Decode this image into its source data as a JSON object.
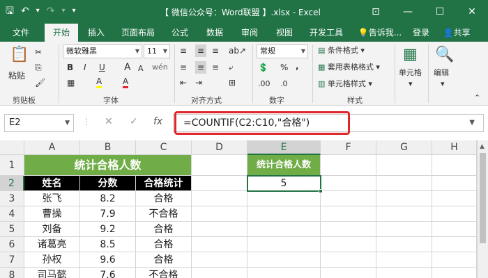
{
  "titlebar": {
    "title": "【 微信公众号：Word联盟 】.xlsx - Excel",
    "qat": {
      "save": "🖫",
      "undo": "↶",
      "undo_menu": "▾",
      "redo": "↷",
      "redo_menu": "▾",
      "customize": "▾"
    },
    "win": {
      "ribbon_opts": "⊡",
      "minimize": "—",
      "maximize": "☐",
      "close": "✕"
    }
  },
  "tabs": {
    "file": "文件",
    "home": "开始",
    "insert": "插入",
    "layout": "页面布局",
    "formulas": "公式",
    "data": "数据",
    "review": "审阅",
    "view": "视图",
    "developer": "开发工具",
    "tellme": "告诉我...",
    "signin": "登录",
    "share": "共享"
  },
  "ribbon": {
    "clipboard": {
      "label": "剪贴板",
      "paste": "粘贴",
      "cut": "✂",
      "copy": "⎘",
      "format_painter": "🖌"
    },
    "font": {
      "label": "字体",
      "name": "微软雅黑",
      "size": "11",
      "bold": "B",
      "italic": "I",
      "underline": "U",
      "grow": "A",
      "shrink": "A",
      "wen": "wén",
      "fill": "A",
      "fontcolor": "A"
    },
    "align": {
      "label": "对齐方式"
    },
    "number": {
      "label": "数字",
      "format": "常规",
      "percent": "%",
      "comma": ",",
      "inc": ".00",
      "dec": ".0"
    },
    "styles": {
      "label": "样式",
      "cond": "条件格式",
      "table": "套用表格格式",
      "cell": "单元格样式"
    },
    "cells": {
      "label": "单元格"
    },
    "editing": {
      "label": "编辑"
    }
  },
  "formula_bar": {
    "name_box": "E2",
    "cancel": "✕",
    "enter": "✓",
    "fx": "fx",
    "formula": "=COUNTIF(C2:C10,\"合格\")"
  },
  "sheet": {
    "columns": [
      "A",
      "B",
      "C",
      "D",
      "E",
      "F",
      "G",
      "H"
    ],
    "rows": [
      "1",
      "2",
      "3",
      "4",
      "5",
      "6",
      "7",
      "8"
    ],
    "title": "统计合格人数",
    "headers": [
      "姓名",
      "分数",
      "合格统计"
    ],
    "data": [
      [
        "张飞",
        "8.2",
        "合格"
      ],
      [
        "曹操",
        "7.9",
        "不合格"
      ],
      [
        "刘备",
        "9.2",
        "合格"
      ],
      [
        "诸葛亮",
        "8.5",
        "合格"
      ],
      [
        "孙权",
        "9.6",
        "合格"
      ],
      [
        "司马懿",
        "7.6",
        "不合格"
      ]
    ],
    "e_title": "统计合格人数",
    "e_value": "5"
  }
}
